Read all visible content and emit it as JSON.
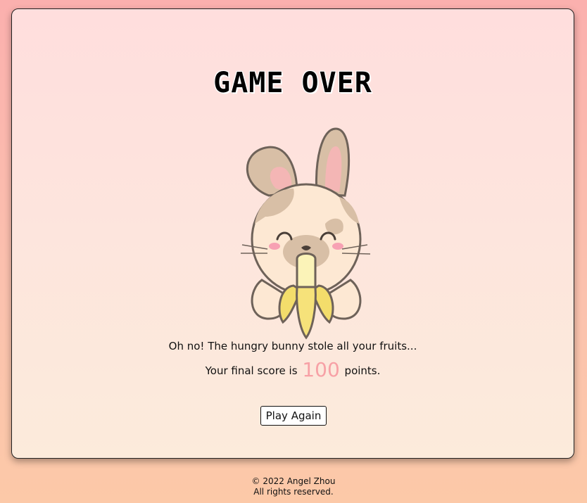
{
  "game": {
    "title": "GAME OVER",
    "message": "Oh no! The hungry bunny stole all your fruits...",
    "score_prefix": "Your final score is",
    "score": "100",
    "score_suffix": "points.",
    "play_again_label": "Play Again",
    "accent_color": "#f7a1a6"
  },
  "footer": {
    "copyright": "© 2022 Angel Zhou",
    "rights": "All rights reserved."
  },
  "icons": {
    "bunny": "bunny-eating-banana-icon"
  }
}
